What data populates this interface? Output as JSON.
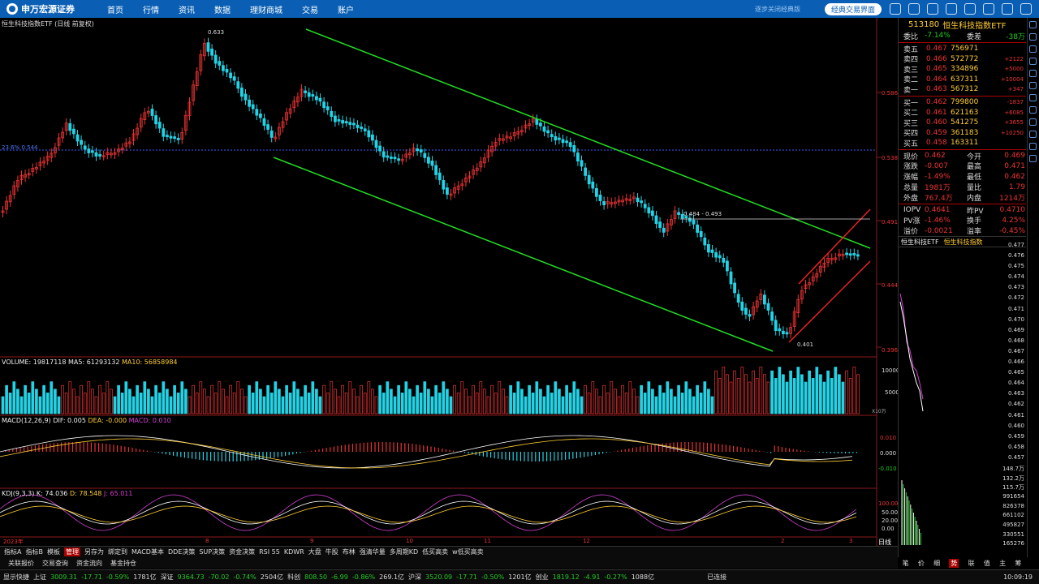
{
  "brand": {
    "name": "申万宏源证券",
    "sub": "SHENWAN HONGYUAN SECURITIES"
  },
  "nav": [
    "首页",
    "行情",
    "资讯",
    "数据",
    "理财商城",
    "交易",
    "账户"
  ],
  "topright": {
    "hint": "逐步关闭经典版",
    "button": "经典交易界面"
  },
  "chart": {
    "title": "恒生科技指数ETF (日线 前复权)",
    "fib_label": "23.6% 0.544",
    "high_label": "0.633",
    "low_label": "0.401",
    "range_label": "0.484 - 0.493",
    "price_ticks": [
      "0.586",
      "0.538",
      "0.491",
      "0.444",
      "0.396"
    ],
    "date_labels": [
      "2023年",
      "8",
      "9",
      "10",
      "11",
      "12",
      "2",
      "3"
    ],
    "period": "日线"
  },
  "volume": {
    "label": "VOLUME: 19817118",
    "ma5": "MA5: 61293132",
    "ma10": "MA10: 56858984",
    "ticks": [
      "10000",
      "5000"
    ],
    "unit": "X10万"
  },
  "macd": {
    "label": "MACD(12,26,9)",
    "dif": "DIF: 0.005",
    "dea": "DEA: -0.000",
    "macd": "MACD: 0.010",
    "ticks": [
      "0.010",
      "0.000",
      "-0.010"
    ]
  },
  "kdj": {
    "label": "KDJ(9,3,3)",
    "k": "K: 74.036",
    "d": "D: 78.548",
    "j": "J: 65.011",
    "ticks": [
      "100.00",
      "50.00",
      "20.00",
      "0.00"
    ]
  },
  "quote": {
    "code": "513180",
    "name": "恒生科技指数ETF",
    "weibi_label": "委比",
    "weibi": "-7.14%",
    "weicha_label": "委差",
    "weicha": "-38万",
    "asks": [
      {
        "l": "卖五",
        "p": "0.467",
        "v": "756971",
        "d": ""
      },
      {
        "l": "卖四",
        "p": "0.466",
        "v": "572772",
        "d": "+2122"
      },
      {
        "l": "卖三",
        "p": "0.465",
        "v": "334896",
        "d": "+5000"
      },
      {
        "l": "卖二",
        "p": "0.464",
        "v": "637311",
        "d": "+10004"
      },
      {
        "l": "卖一",
        "p": "0.463",
        "v": "567312",
        "d": "+347"
      }
    ],
    "bids": [
      {
        "l": "买一",
        "p": "0.462",
        "v": "799800",
        "d": "-1837"
      },
      {
        "l": "买二",
        "p": "0.461",
        "v": "621163",
        "d": "+6085"
      },
      {
        "l": "买三",
        "p": "0.460",
        "v": "541275",
        "d": "+3655"
      },
      {
        "l": "买四",
        "p": "0.459",
        "v": "361183",
        "d": "+10250"
      },
      {
        "l": "买五",
        "p": "0.458",
        "v": "163311",
        "d": ""
      }
    ],
    "stats": [
      {
        "a": "现价",
        "b": "0.462",
        "c": "今开",
        "e": "0.469"
      },
      {
        "a": "涨跌",
        "b": "-0.007",
        "c": "最高",
        "e": "0.471"
      },
      {
        "a": "涨幅",
        "b": "-1.49%",
        "c": "最低",
        "e": "0.462"
      },
      {
        "a": "总量",
        "b": "1981万",
        "c": "量比",
        "e": "1.79"
      },
      {
        "a": "外盘",
        "b": "767.4万",
        "c": "内盘",
        "e": "1214万"
      }
    ],
    "iopv": [
      {
        "a": "IOPV",
        "b": "0.4641",
        "c": "昨PV",
        "e": "0.4710"
      },
      {
        "a": "PV涨",
        "b": "-1.46%",
        "c": "换手",
        "e": "4.25%"
      },
      {
        "a": "溢价",
        "b": "-0.0021",
        "c": "溢率",
        "e": "-0.45%"
      }
    ],
    "tabs": [
      "恒生科技ETF",
      "恒生科技指数"
    ],
    "tick_prices": [
      "0.477",
      "0.476",
      "0.475",
      "0.474",
      "0.473",
      "0.472",
      "0.471",
      "0.470",
      "0.469",
      "0.468",
      "0.467",
      "0.466",
      "0.465",
      "0.464",
      "0.463",
      "0.462",
      "0.461",
      "0.460",
      "0.459",
      "0.458",
      "0.457"
    ],
    "vol_ticks": [
      "148.7万",
      "132.2万",
      "115.7万",
      "991654",
      "826378",
      "661102",
      "495827",
      "330551",
      "165276"
    ]
  },
  "tabbar": [
    "指标A",
    "指标B",
    "模板",
    "管理",
    "另存为",
    "绑定到",
    "MACD基本",
    "DDE决策",
    "SUP决策",
    "资金决策",
    "RSI 55",
    "KDWR",
    "大盘",
    "牛股",
    "布林",
    "强清华量",
    "多周期KD",
    "低买高卖",
    "w低买高卖"
  ],
  "tabbar_active": "管理",
  "tabbar2": [
    "关联报价",
    "交易查询",
    "资金流向",
    "基金持仓"
  ],
  "rb_tabs": [
    "笔",
    "价",
    "细",
    "势",
    "联",
    "值",
    "主",
    "筹"
  ],
  "rb_active": "势",
  "status": {
    "quick": "显示快捷",
    "sh": [
      "上证",
      "3009.31",
      "-17.71",
      "-0.59%",
      "1781亿"
    ],
    "sz": [
      "深证",
      "9364.73",
      "-70.02",
      "-0.74%",
      "2504亿"
    ],
    "kc": [
      "科创",
      "808.50",
      "-6.99",
      "-0.86%",
      "269.1亿"
    ],
    "hs": [
      "沪深",
      "3520.09",
      "-17.71",
      "-0.50%",
      "1201亿"
    ],
    "cy": [
      "创业",
      "1819.12",
      "-4.91",
      "-0.27%",
      "1088亿"
    ],
    "conn": "已连接",
    "time": "10:09:19"
  }
}
